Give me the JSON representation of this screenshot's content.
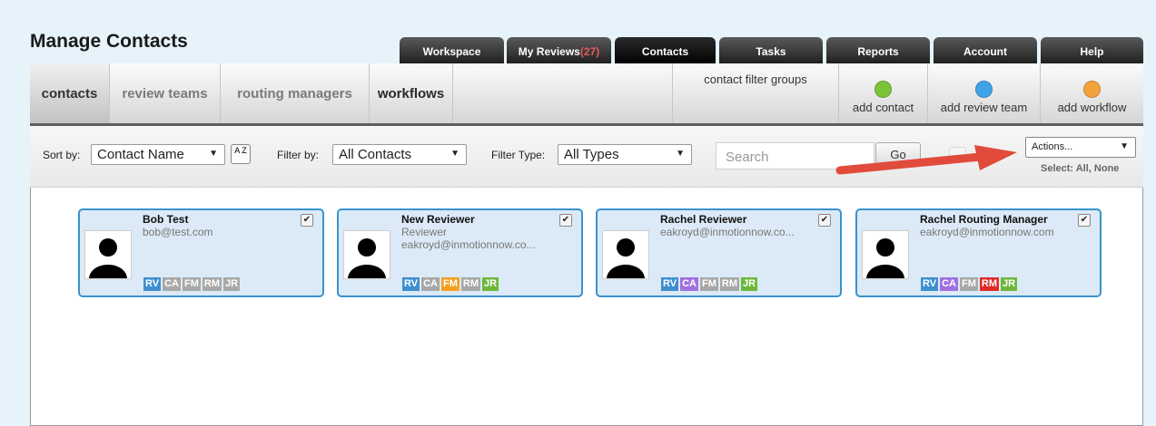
{
  "page": {
    "title": "Manage Contacts"
  },
  "top_tabs": [
    {
      "label": "Workspace"
    },
    {
      "label": "My Reviews",
      "count": "(27)"
    },
    {
      "label": "Contacts",
      "active": true
    },
    {
      "label": "Tasks"
    },
    {
      "label": "Reports"
    },
    {
      "label": "Account"
    },
    {
      "label": "Help"
    }
  ],
  "subnav": {
    "tabs": [
      {
        "label": "contacts"
      },
      {
        "label": "review teams"
      },
      {
        "label": "routing managers"
      },
      {
        "label": "workflows"
      }
    ],
    "filter_groups": "contact filter groups",
    "add_buttons": [
      {
        "label": "add contact",
        "color": "#7cc33a"
      },
      {
        "label": "add review team",
        "color": "#3fa3e8"
      },
      {
        "label": "add workflow",
        "color": "#f4a23a"
      }
    ]
  },
  "toolbar": {
    "sort_label": "Sort by:",
    "sort_value": "Contact Name",
    "sort_button": "A Z",
    "filter_label": "Filter by:",
    "filter_value": "All Contacts",
    "type_label": "Filter Type:",
    "type_value": "All Types",
    "search_placeholder": "Search",
    "go_label": "Go",
    "actions_value": "Actions...",
    "select_prefix": "Select:",
    "select_all": "All",
    "select_sep": ",",
    "select_none": "None"
  },
  "roles": {
    "RV": "#3f8fcf",
    "CA": "#a070e0",
    "FM": "#f5a020",
    "RM": "#e02a2a",
    "JR": "#6db83a",
    "inactive": "#a8a8a8"
  },
  "contacts": [
    {
      "name": "Bob Test",
      "line1": "bob@test.com",
      "line2": "",
      "active_roles": [
        "RV"
      ]
    },
    {
      "name": "New Reviewer",
      "line1": "Reviewer",
      "line2": "eakroyd@inmotionnow.co...",
      "active_roles": [
        "RV",
        "FM",
        "JR"
      ]
    },
    {
      "name": "Rachel Reviewer",
      "line1": "eakroyd@inmotionnow.co...",
      "line2": "",
      "active_roles": [
        "RV",
        "CA",
        "JR"
      ]
    },
    {
      "name": "Rachel Routing Manager",
      "line1": "eakroyd@inmotionnow.com",
      "line2": "",
      "active_roles": [
        "RV",
        "CA",
        "RM",
        "JR"
      ]
    }
  ]
}
